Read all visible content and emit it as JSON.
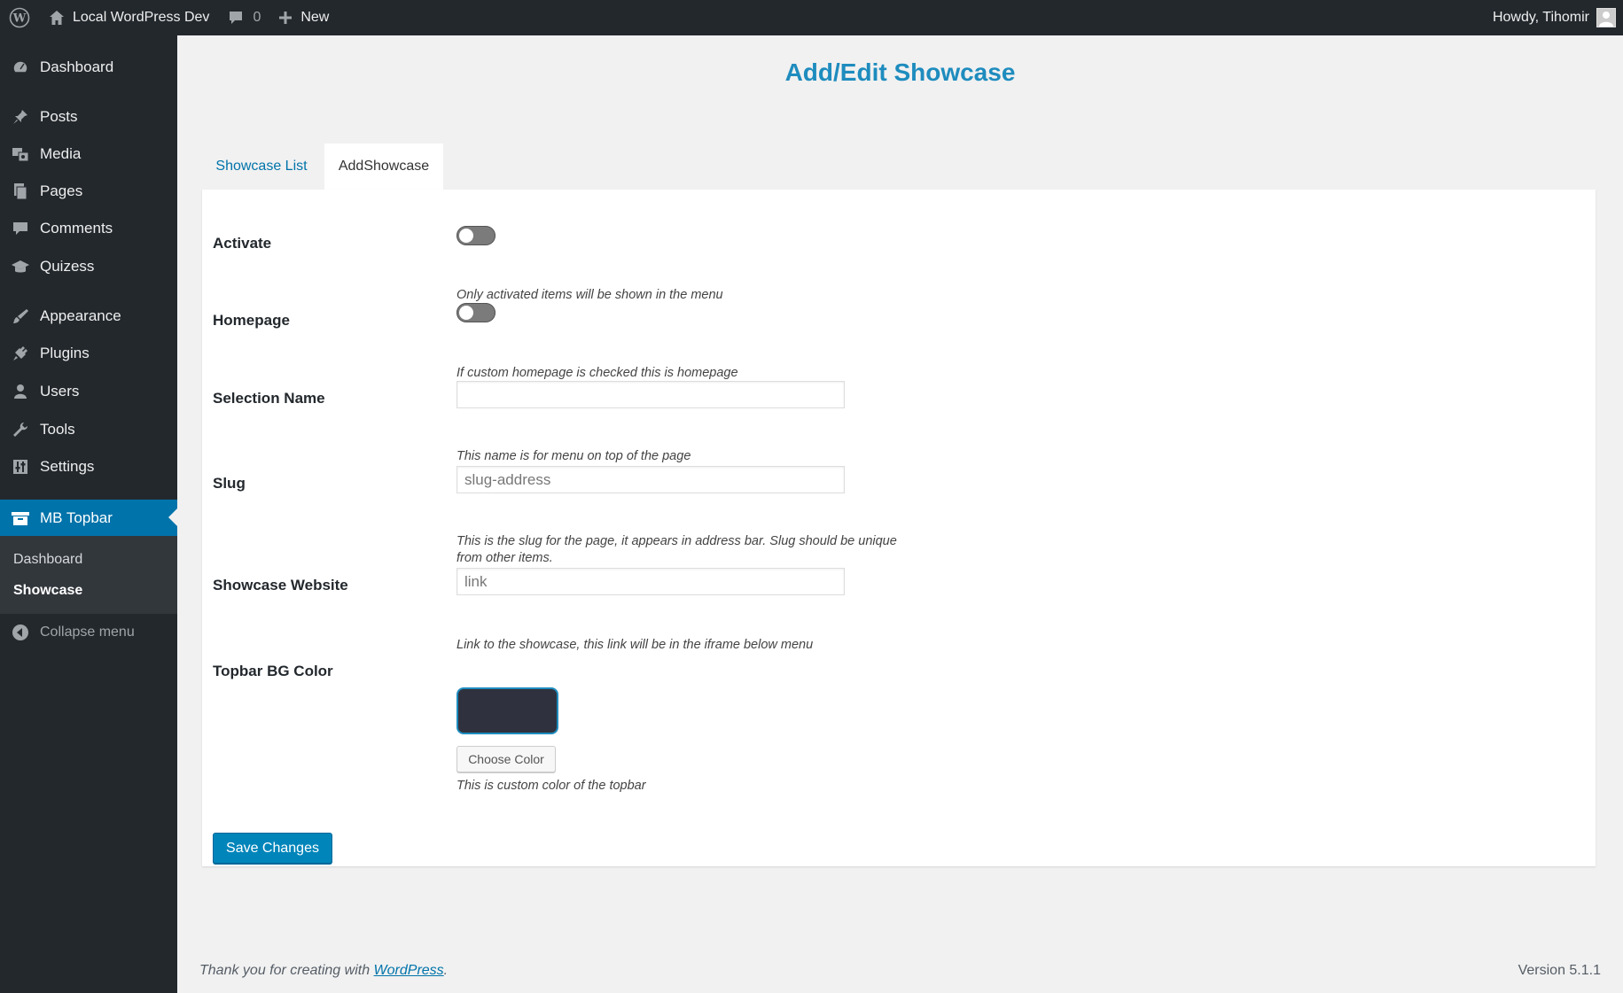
{
  "admin_bar": {
    "site_name": "Local WordPress Dev",
    "comments_count": "0",
    "new_label": "New",
    "howdy": "Howdy, Tihomir"
  },
  "sidebar": {
    "items": [
      {
        "label": "Dashboard",
        "icon": "dashboard-icon"
      },
      {
        "label": "Posts",
        "icon": "pushpin-icon"
      },
      {
        "label": "Media",
        "icon": "media-icon"
      },
      {
        "label": "Pages",
        "icon": "pages-icon"
      },
      {
        "label": "Comments",
        "icon": "comment-bubble-icon"
      },
      {
        "label": "Quizess",
        "icon": "graduation-cap-icon"
      },
      {
        "label": "Appearance",
        "icon": "paintbrush-icon"
      },
      {
        "label": "Plugins",
        "icon": "plug-icon"
      },
      {
        "label": "Users",
        "icon": "user-icon"
      },
      {
        "label": "Tools",
        "icon": "wrench-icon"
      },
      {
        "label": "Settings",
        "icon": "sliders-icon"
      },
      {
        "label": "MB Topbar",
        "icon": "archive-box-icon"
      }
    ],
    "submenu": [
      "Dashboard",
      "Showcase"
    ],
    "collapse_label": "Collapse menu"
  },
  "page": {
    "title": "Add/Edit Showcase",
    "tabs": [
      "Showcase List",
      "AddShowcase"
    ]
  },
  "form": {
    "activate_label": "Activate",
    "activate_desc": "Only activated items will be shown in the menu",
    "homepage_label": "Homepage",
    "homepage_desc": "If custom homepage is checked this is homepage",
    "selection_name_label": "Selection Name",
    "selection_name_value": "",
    "selection_name_desc": "This name is for menu on top of the page",
    "slug_label": "Slug",
    "slug_placeholder": "slug-address",
    "slug_desc": "This is the slug for the page, it appears in address bar. Slug should be unique from other items.",
    "website_label": "Showcase Website",
    "website_placeholder": "link",
    "website_desc": "Link to the showcase, this link will be in the iframe below menu",
    "color_label": "Topbar BG Color",
    "color_value": "#2f323e",
    "choose_color": "Choose Color",
    "color_desc": "This is custom color of the topbar",
    "save_label": "Save Changes"
  },
  "footer": {
    "thanks_prefix": "Thank you for creating with ",
    "thanks_link": "WordPress",
    "thanks_suffix": ".",
    "version": "Version 5.1.1"
  }
}
